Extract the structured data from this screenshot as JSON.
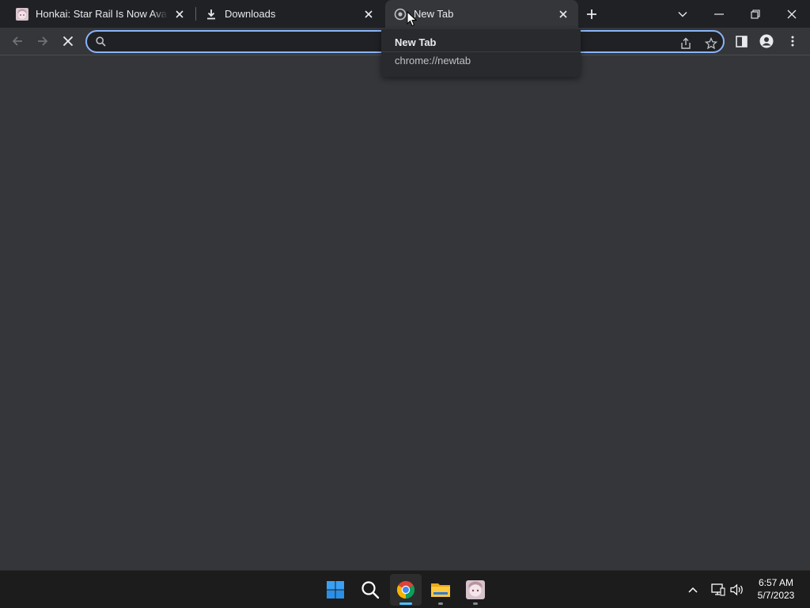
{
  "browser": {
    "tabs": [
      {
        "title": "Honkai: Star Rail Is Now Available",
        "favicon": "anime-avatar-icon",
        "active": false
      },
      {
        "title": "Downloads",
        "favicon": "download-icon",
        "active": false
      },
      {
        "title": "New Tab",
        "favicon": "chrome-newtab-icon",
        "active": true
      }
    ],
    "hover_card": {
      "title": "New Tab",
      "url": "chrome://newtab"
    },
    "omnibox": {
      "value": "",
      "placeholder": ""
    },
    "icons": {
      "back": "arrow-left-icon",
      "forward": "arrow-right-icon",
      "stop": "close-icon",
      "share": "share-icon",
      "bookmark": "star-icon",
      "side_panel": "side-panel-icon",
      "profile": "profile-icon",
      "menu": "kebab-menu-icon"
    }
  },
  "taskbar": {
    "apps": [
      {
        "name": "Start",
        "icon": "windows-start-icon"
      },
      {
        "name": "Search",
        "icon": "search-icon"
      },
      {
        "name": "Google Chrome",
        "icon": "chrome-icon",
        "active": true
      },
      {
        "name": "File Explorer",
        "icon": "folder-icon"
      },
      {
        "name": "Game",
        "icon": "anime-avatar-icon"
      }
    ],
    "clock": {
      "time": "6:57 AM",
      "date": "5/7/2023"
    }
  },
  "colors": {
    "tabstrip_bg": "#202124",
    "toolbar_bg": "#35363a",
    "omnibox_border": "#8ab4f8",
    "taskbar_bg": "#1c1c1c",
    "taskbar_active_indicator": "#4cc2ff"
  }
}
